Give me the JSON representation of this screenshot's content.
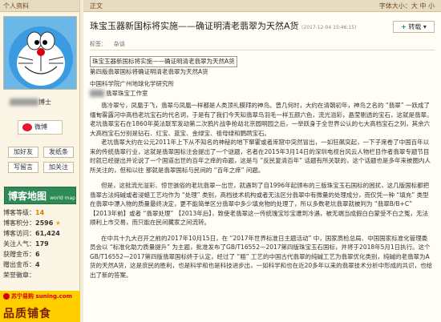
{
  "sidebar": {
    "header": "个人资料",
    "username_suffix": "博士",
    "weibo_label": "微博",
    "buttons": {
      "add_friend": "加好友",
      "send_note": "发纸条",
      "write_msg": "写留言",
      "add_follow": "加关注"
    },
    "map": {
      "title": "博客地图",
      "sub": "world map"
    },
    "stats": [
      {
        "label": "博客等级：",
        "value": "14"
      },
      {
        "label": "博客积分：",
        "value": "2596"
      },
      {
        "label": "博客访问：",
        "value": "61,424"
      },
      {
        "label": "关注人气：",
        "value": "179"
      },
      {
        "label": "获赠金币：",
        "value": "6"
      },
      {
        "label": "赠出金币：",
        "value": "4"
      },
      {
        "label": "荣誉徽章：",
        "value": ""
      }
    ],
    "ad": {
      "brand": "苏宁易购",
      "domain": "suning.com",
      "slogan": "品质铺食"
    }
  },
  "main": {
    "tab": "正文",
    "font_size": "字体大小：大 中 小",
    "title": "珠宝玉器新国标将实施——确证明清老翡翠为天然A货",
    "date": "(2017-12-04 15:46:15)",
    "share_button": "转载",
    "tag_label": "标签：",
    "tag": "杂谈",
    "content": {
      "quote_line": "珠宝玉器新国标将实施——确证明清老翡翠为天然A货",
      "line2": "第四版翡翠国标将确证明清老翡翠为天然A货",
      "org1": "中国科学院广州地球化学研究所",
      "org2": "翡翠珠宝工作室",
      "p1": "翡冷翠兮，凤凰于飞，翡翠与凤凰一样都是人类顶礼膜拜的神鸟。曾几何时，大约在清朝初年，神鸟之名的 “翡翠” 一跃成了缅甸雾露河中高档老坑宝石的代名词，于是有了我们今天知翡翠鸟羽毛一样五颜六色，流光溢彩，晶莹剔透的宝石，这就是翡翠。老坑翡翠宝石在1860年英法联军发动第二次鸦片战争抢劫北京圆明园之后，一举跃身于全世界公认的七大高档宝石之列，其余六大高档宝石分别是钻石、红宝、蓝宝、金绿宝、祖母绿和鹦鹉宝石。",
      "p2": "老坑翡翠大约在公元2011年上下从不知名的神秘的地下窜霍或者库窟中突然冒出，一如狂飙突起，一下子席卷了中国百年以来的传统翡翠行业，这就是翡翠国标注会提出了一个谜题，名者在2015年3月14日的深圳电视台风云人物栏目作者翡翠专题节目时就已经提出并论说了一个国道出世的百年之痒的命题，这是与 “反民复清百年” 话题有所关联的，这个话题也是多年来被圈内人所关注的，但和以往 那就是翡翠国标与民间的 “百年之痒” 问题。",
      "p3": "但是，这批流光溢彩、惊世骇俗的老坑翡翠一出世，就遇到了自1996年起颁布的三版珠宝玉石国标的困扰，这几版国标都把翡翠古法纯碱或者浸蜡工艺均作为 “处理” 类别，高档技术机构或者无法区分翡翠中有微量的处理成分，而仅凭一种 “填充” 类型在翡翠中漂入物的质量最终决定，更不能简单区分翡翠中多少填充物的处理了，所以多数老坑翡翠就被判为 “翡翠B/B+C” 【2013年前】或者 “翡翠处理” 【2013年后】，致使老翡翠这一传统瑰宝珍宝遭到冷遇，被无端当成假白白蒙受不白之冤，无法顺利上市交易，而只能在民间藏家之间流转。",
      "p4": "在中共十九大召开之前的2017年10月15日，在 “2017年世界标准日主题活动” 中，国家质检总局、中国国家标准化管理委员会以 “标准化助力质量提升” 为主题，批准发布了GB/T16552—2017第四版珠宝玉石国标，并将于2018年5月1日执行。这个GB/T16552—2017第四版翡翠国标终于认定，经过了 “粗” 工艺的中国古代翡翠的纯碱工艺为翡翠优化类别，纯碱的老翡翠为A货的天然A货，这是庶民的胜利，也是科学和也是科技进步出，一如科学和也在近20多年以来的翡翠技术分析中形成的共识，也给出了新的答案。"
    }
  }
}
